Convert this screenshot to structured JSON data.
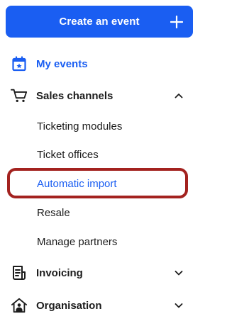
{
  "create_button": {
    "label": "Create an event",
    "plus_icon": "plus-icon"
  },
  "nav": {
    "my_events": {
      "label": "My events",
      "icon": "calendar-star-icon",
      "color": "#1a5ef2"
    },
    "sales_channels": {
      "label": "Sales channels",
      "icon": "shopping-cart-icon",
      "expanded": true,
      "items": [
        {
          "label": "Ticketing modules"
        },
        {
          "label": "Ticket offices"
        },
        {
          "label": "Automatic import",
          "active": true
        },
        {
          "label": "Resale"
        },
        {
          "label": "Manage partners"
        }
      ]
    },
    "invoicing": {
      "label": "Invoicing",
      "icon": "invoice-icon",
      "expanded": false
    },
    "organisation": {
      "label": "Organisation",
      "icon": "house-icon",
      "expanded": false
    }
  },
  "colors": {
    "accent": "#1a5ef2",
    "highlight_border": "#a3221f",
    "text": "#1c1c1c"
  }
}
